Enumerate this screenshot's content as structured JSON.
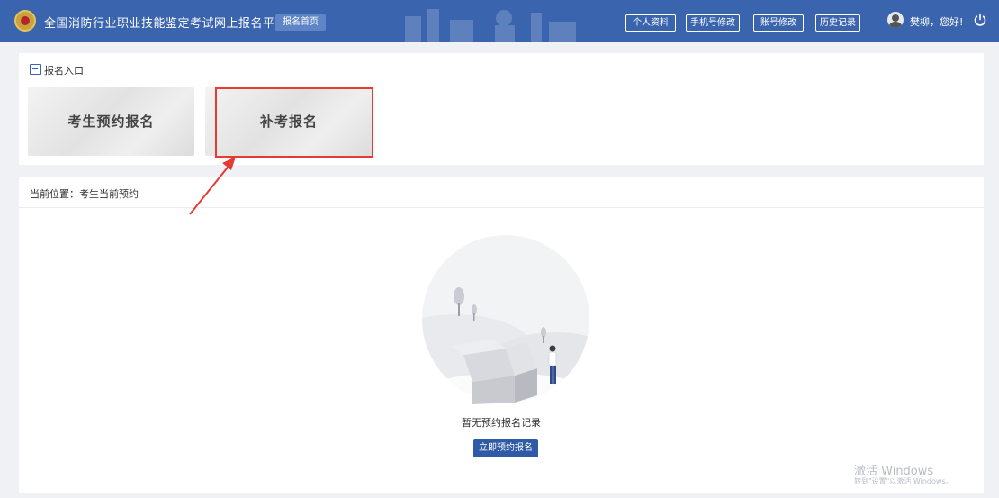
{
  "header": {
    "title": "全国消防行业职业技能鉴定考试网上报名平台",
    "home_button": "报名首页",
    "buttons": [
      "个人资料",
      "手机号修改",
      "账号修改",
      "历史记录"
    ],
    "greeting": "樊柳，您好!",
    "logo_icon": "emblem-icon",
    "power_icon": "power-icon",
    "bg_color": "#3a64ad"
  },
  "entry": {
    "label": "报名入口",
    "cards": [
      "考生预约报名",
      "补考报名"
    ],
    "highlight_color": "#e73a33"
  },
  "current": {
    "breadcrumb": "当前位置：考生当前预约",
    "empty_text": "暂无预约报名记录",
    "reserve_button": "立即预约报名"
  },
  "watermark": {
    "line1": "激活 Windows",
    "line2": "转到\"设置\"以激活 Windows。"
  }
}
